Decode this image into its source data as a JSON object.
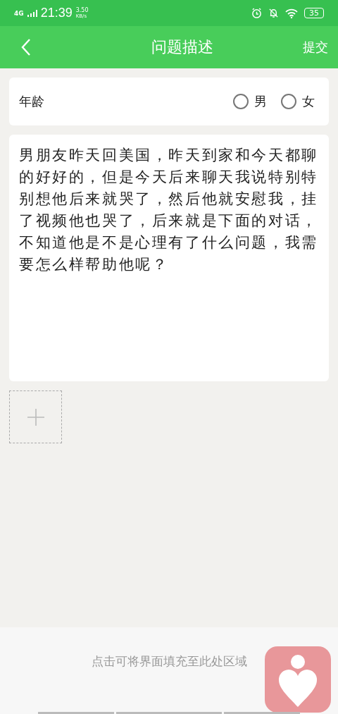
{
  "status_bar": {
    "network": "4G",
    "time": "21:39",
    "speed_value": "3.50",
    "speed_unit": "KB/s",
    "battery": "35"
  },
  "nav": {
    "title": "问题描述",
    "action": "提交"
  },
  "age": {
    "label": "年龄",
    "options": [
      {
        "label": "男",
        "selected": false
      },
      {
        "label": "女",
        "selected": false
      }
    ]
  },
  "description": {
    "value": "男朋友昨天回美国，昨天到家和今天都聊的好好的，但是今天后来聊天我说特别特别想他后来就哭了，然后他就安慰我，挂了视频他也哭了，后来就是下面的对话，不知道他是不是心理有了什么问题，我需要怎么样帮助他呢？"
  },
  "footer": {
    "hint": "点击可将界面填充至此处区域"
  }
}
